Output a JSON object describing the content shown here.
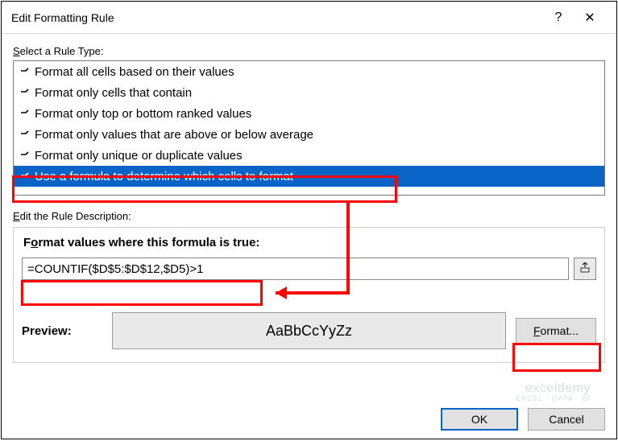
{
  "dialog": {
    "title": "Edit Formatting Rule",
    "help_symbol": "?",
    "close_symbol": "✕"
  },
  "ruletype": {
    "label_pre": "S",
    "label_post": "elect a Rule Type:",
    "items": [
      "Format all cells based on their values",
      "Format only cells that contain",
      "Format only top or bottom ranked values",
      "Format only values that are above or below average",
      "Format only unique or duplicate values",
      "Use a formula to determine which cells to format"
    ],
    "selected_index": 5
  },
  "description": {
    "label_pre": "E",
    "label_post": "dit the Rule Description:",
    "formula_label_pre": "F",
    "formula_label_u": "o",
    "formula_label_post": "rmat values where this formula is true:",
    "formula_value": "=COUNTIF($D$5:$D$12,$D5)>1"
  },
  "preview": {
    "label": "Preview:",
    "sample": "AaBbCcYyZz",
    "format_btn_u": "F",
    "format_btn_rest": "ormat..."
  },
  "buttons": {
    "ok": "OK",
    "cancel": "Cancel"
  },
  "watermark": {
    "line1": "exceldemy",
    "line2": "EXCEL · DATA · BI"
  }
}
